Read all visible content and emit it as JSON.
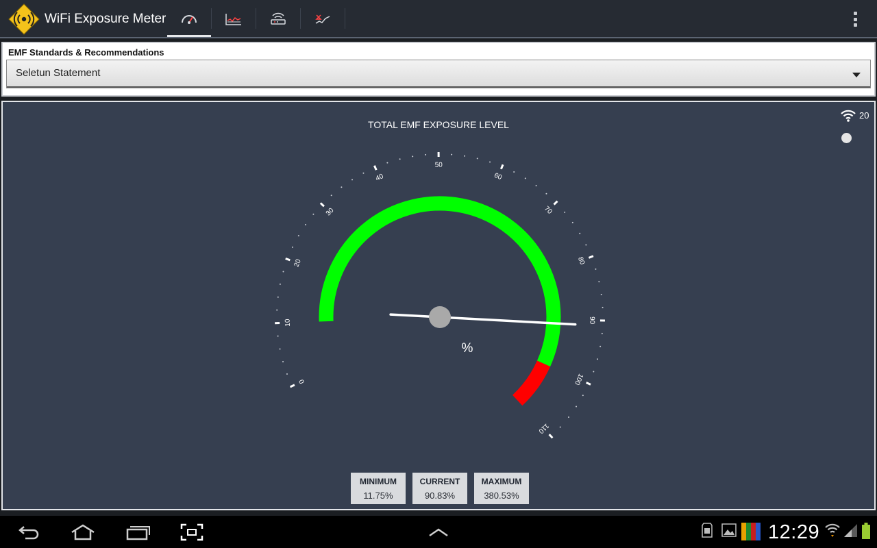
{
  "app": {
    "title": "WiFi Exposure Meter",
    "logo_icon": "wifi-warning-sign-icon"
  },
  "tabs": [
    {
      "name": "gauge",
      "icon": "speedometer-icon",
      "active": true
    },
    {
      "name": "chart",
      "icon": "line-chart-icon",
      "active": false
    },
    {
      "name": "router",
      "icon": "router-icon",
      "active": false
    },
    {
      "name": "trend",
      "icon": "trend-icon",
      "active": false
    }
  ],
  "standards": {
    "title": "EMF Standards & Recommendations",
    "selected": "Seletun Statement"
  },
  "meter": {
    "title": "TOTAL EMF EXPOSURE LEVEL",
    "wifi_networks": "20",
    "unit": "%",
    "scale_min": 0,
    "scale_max": 110,
    "major_ticks": [
      0,
      10,
      20,
      30,
      40,
      50,
      60,
      70,
      80,
      90,
      100,
      110
    ],
    "needle_value": 90.83,
    "arc_green_range": [
      10,
      100
    ],
    "arc_red_range": [
      100,
      110
    ],
    "colors": {
      "safe": "#00ff00",
      "danger": "#ff0000",
      "needle": "#ffffff",
      "hub": "#a9a9a9"
    }
  },
  "stats": {
    "minimum_label": "MINIMUM",
    "minimum_value": "11.75%",
    "current_label": "CURRENT",
    "current_value": "90.83%",
    "maximum_label": "MAXIMUM",
    "maximum_value": "380.53%"
  },
  "statusbar": {
    "time": "12:29",
    "icons": [
      "sd-card-icon",
      "gallery-icon",
      "app-notification-icon",
      "wifi-signal-icon",
      "cell-signal-icon",
      "battery-icon"
    ]
  },
  "navbar": {
    "buttons": [
      "back-icon",
      "home-icon",
      "recent-apps-icon",
      "screenshot-icon"
    ],
    "center": "chevron-up-icon"
  }
}
